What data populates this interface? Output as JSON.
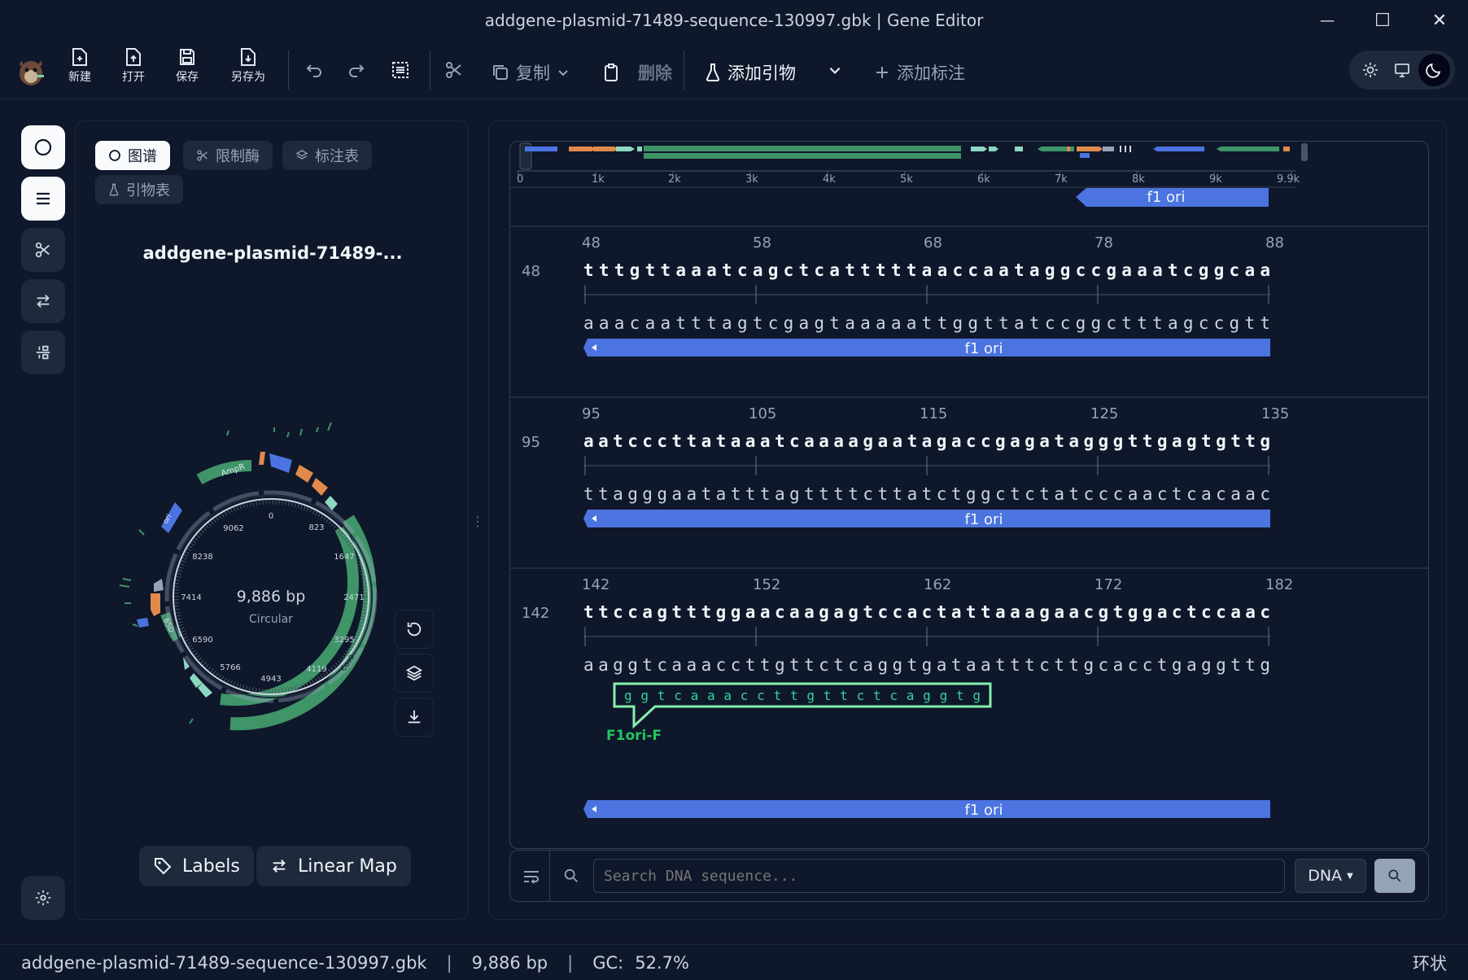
{
  "window": {
    "title": "addgene-plasmid-71489-sequence-130997.gbk | Gene Editor",
    "minimize": "—",
    "maximize": "☐",
    "close": "✕"
  },
  "toolbar": {
    "new_label": "新建",
    "open_label": "打开",
    "save_label": "保存",
    "saveas_label": "另存为",
    "copy_label": "复制",
    "delete_label": "删除",
    "add_primer_label": "添加引物",
    "add_annotation_label": "添加标注"
  },
  "map": {
    "tabs": [
      "图谱",
      "限制酶",
      "标注表",
      "引物表"
    ],
    "title": "addgene-plasmid-71489-...",
    "bp_text": "9,886 bp",
    "shape_text": "Circular",
    "ticks": [
      "0",
      "823",
      "1647",
      "2471",
      "3295",
      "4119",
      "4943",
      "5766",
      "6590",
      "7414",
      "8238",
      "9062"
    ],
    "feature_labels": [
      "AmpR",
      "ori",
      "BSD",
      "Cas9",
      "Cas9"
    ],
    "labels_button": "Labels",
    "linear_map_button": "Linear Map"
  },
  "overview": {
    "ticks": [
      "0",
      "1k",
      "2k",
      "3k",
      "4k",
      "5k",
      "6k",
      "7k",
      "8k",
      "9k",
      "9.9k"
    ],
    "feature_label": "f1 ori"
  },
  "sequence": {
    "rows": [
      {
        "index": "48",
        "ruler": [
          "48",
          "58",
          "68",
          "78",
          "88"
        ],
        "top": "tttgttaaatcagctcatttttaaccaataggccgaaatcggcaa",
        "bottom": "aaacaatttagtcgagtaaaaattggttatccggctttagccgtt",
        "feature": "f1 ori"
      },
      {
        "index": "95",
        "ruler": [
          "95",
          "105",
          "115",
          "125",
          "135"
        ],
        "top": "aatcccttataaatcaaaagaatagaccgagatagggttgagtgttg",
        "bottom": "ttagggaatatttagttttcttatctggctctatcccaactcacaac",
        "feature": "f1 ori"
      },
      {
        "index": "142",
        "ruler": [
          "142",
          "152",
          "162",
          "172",
          "182"
        ],
        "top": "ttccagtttggaacaagagtccactattaaagaacgtggactccaac",
        "bottom": "aaggtcaaaccttgttctcaggtgataatttcttgcacctgaggttg",
        "primer_seq": "ggtcaaaccttgttctcaggtg",
        "primer_name": "F1ori-F",
        "feature": "f1 ori"
      }
    ]
  },
  "search": {
    "placeholder": "Search DNA sequence...",
    "type_label": "DNA"
  },
  "status": {
    "file": "addgene-plasmid-71489-sequence-130997.gbk",
    "length": "9,886 bp",
    "gc_label": "GC:",
    "gc_value": "52.7%",
    "topology": "环状"
  },
  "colors": {
    "background": "#0f172a",
    "feature_blue": "#4b74e0",
    "feature_green": "#3f9468",
    "feature_orange": "#e08a4b",
    "feature_teal": "#8dd6c2",
    "primer_green": "#34d399"
  }
}
